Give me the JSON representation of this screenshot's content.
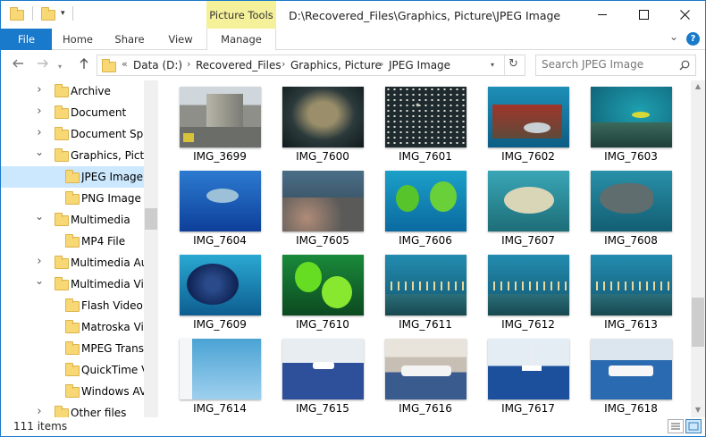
{
  "window": {
    "contextual_tab_group": "Picture Tools",
    "title": "D:\\Recovered_Files\\Graphics, Picture\\JPEG Image"
  },
  "ribbon": {
    "tabs": [
      {
        "label": "File"
      },
      {
        "label": "Home"
      },
      {
        "label": "Share"
      },
      {
        "label": "View"
      },
      {
        "label": "Manage"
      }
    ]
  },
  "address": {
    "overflow": "«",
    "crumbs": [
      "Data (D:)",
      "Recovered_Files",
      "Graphics, Picture",
      "JPEG Image"
    ]
  },
  "search": {
    "placeholder": "Search JPEG Image"
  },
  "nav": {
    "items": [
      {
        "label": "Archive",
        "expander": "collapsed"
      },
      {
        "label": "Document",
        "expander": "collapsed"
      },
      {
        "label": "Document Spre",
        "expander": "collapsed"
      },
      {
        "label": "Graphics, Pictur",
        "expander": "expanded"
      },
      {
        "label": "JPEG Image",
        "expander": "none"
      },
      {
        "label": "PNG Image",
        "expander": "none"
      },
      {
        "label": "Multimedia",
        "expander": "expanded"
      },
      {
        "label": "MP4 File",
        "expander": "none"
      },
      {
        "label": "Multimedia Aud",
        "expander": "collapsed"
      },
      {
        "label": "Multimedia Vide",
        "expander": "expanded"
      },
      {
        "label": "Flash Video",
        "expander": "none"
      },
      {
        "label": "Matroska Vide",
        "expander": "none"
      },
      {
        "label": "MPEG Transpo",
        "expander": "none"
      },
      {
        "label": "QuickTime Vid",
        "expander": "none"
      },
      {
        "label": "Windows AVI F",
        "expander": "none"
      },
      {
        "label": "Other files",
        "expander": "collapsed"
      }
    ]
  },
  "files": [
    {
      "name": "IMG_3699",
      "scene": "street"
    },
    {
      "name": "IMG_7600",
      "scene": "dark-reef"
    },
    {
      "name": "IMG_7601",
      "scene": "fish-school"
    },
    {
      "name": "IMG_7602",
      "scene": "wreck"
    },
    {
      "name": "IMG_7603",
      "scene": "reef"
    },
    {
      "name": "IMG_7604",
      "scene": "blue-fish"
    },
    {
      "name": "IMG_7605",
      "scene": "coral"
    },
    {
      "name": "IMG_7606",
      "scene": "yellow-fish"
    },
    {
      "name": "IMG_7607",
      "scene": "trigger"
    },
    {
      "name": "IMG_7608",
      "scene": "grouper"
    },
    {
      "name": "IMG_7609",
      "scene": "angelfish"
    },
    {
      "name": "IMG_7610",
      "scene": "yellow-pair"
    },
    {
      "name": "IMG_7611",
      "scene": "school-reef"
    },
    {
      "name": "IMG_7612",
      "scene": "school-reef"
    },
    {
      "name": "IMG_7613",
      "scene": "school-reef"
    },
    {
      "name": "IMG_7614",
      "scene": "water"
    },
    {
      "name": "IMG_7615",
      "scene": "boat"
    },
    {
      "name": "IMG_7616",
      "scene": "yacht"
    },
    {
      "name": "IMG_7617",
      "scene": "sailboat"
    },
    {
      "name": "IMG_7618",
      "scene": "harbor"
    }
  ],
  "status": {
    "item_count": "111 items"
  },
  "colors": {
    "accent": "#1979ca",
    "contextual_tab": "#f5f19a",
    "selected": "#cce8ff",
    "folder": "#f8d775"
  },
  "icons": [
    "folder-icon",
    "pin-dropdown-icon",
    "minimize-icon",
    "maximize-icon",
    "close-icon",
    "help-icon",
    "back-icon",
    "forward-icon",
    "recent-icon",
    "up-icon",
    "refresh-icon",
    "search-icon",
    "chevron-icon",
    "details-view-icon",
    "thumbnails-view-icon"
  ]
}
